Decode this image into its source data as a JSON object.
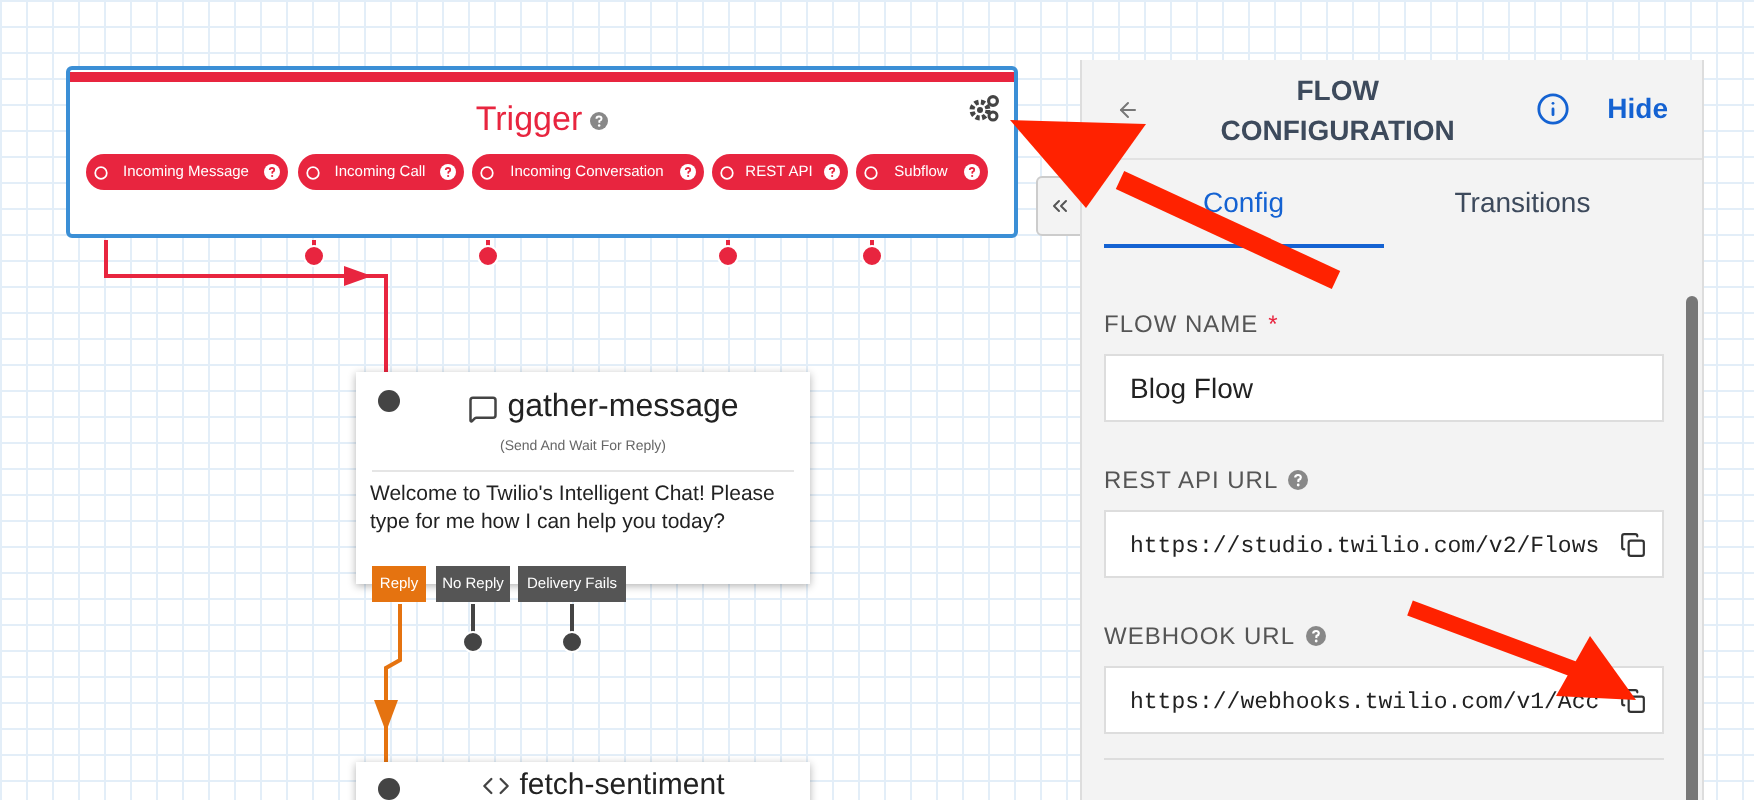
{
  "trigger": {
    "title": "Trigger",
    "triggers": [
      {
        "label": "Incoming Message",
        "connected": true
      },
      {
        "label": "Incoming Call",
        "connected": false
      },
      {
        "label": "Incoming Conversation",
        "connected": false
      },
      {
        "label": "REST API",
        "connected": false
      },
      {
        "label": "Subflow",
        "connected": false
      }
    ]
  },
  "widgets": [
    {
      "title": "gather-message",
      "subtitle": "(Send And Wait For Reply)",
      "body": "Welcome to Twilio's Intelligent Chat! Please type for me how I can help you today?",
      "transitions": [
        {
          "label": "Reply",
          "connected": true
        },
        {
          "label": "No Reply",
          "connected": false
        },
        {
          "label": "Delivery Fails",
          "connected": false
        }
      ]
    },
    {
      "title": "fetch-sentiment"
    }
  ],
  "panel": {
    "title": "FLOW CONFIGURATION",
    "hide": "Hide",
    "tabs": [
      {
        "label": "Config",
        "selected": true
      },
      {
        "label": "Transitions",
        "selected": false
      }
    ],
    "fields": [
      {
        "label": "FLOW NAME",
        "required_mark": "*",
        "help": false,
        "value": "Blog Flow",
        "kind": "text"
      },
      {
        "label": "REST API URL",
        "help": true,
        "value": "https://studio.twilio.com/v2/Flows",
        "kind": "url"
      },
      {
        "label": "WEBHOOK URL",
        "help": true,
        "value": "https://webhooks.twilio.com/v1/Acc",
        "kind": "url"
      }
    ]
  }
}
